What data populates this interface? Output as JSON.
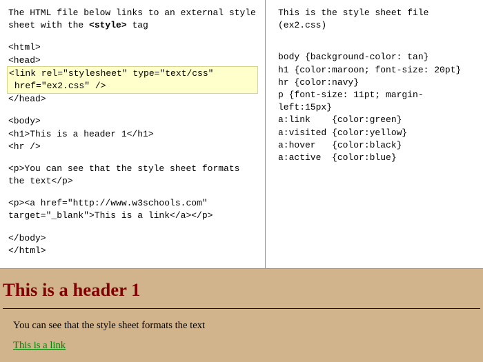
{
  "left": {
    "intro_before": "The HTML file below links to an external style sheet with the ",
    "intro_bold": "<style>",
    "intro_after": " tag",
    "lines": [
      "<html>",
      "<head>",
      "HILITE",
      "</head>",
      "",
      "<body>",
      "<h1>This is a header 1</h1>",
      "<hr />",
      "",
      "<p>You can see that the style sheet formats the text</p>",
      "",
      "<p><a href=\"http://www.w3schools.com\" target=\"_blank\">This is a link</a></p>",
      "",
      "</body>",
      "</html>"
    ],
    "hilite_line1": "<link rel=\"stylesheet\" type=\"text/css\"",
    "hilite_line2": " href=\"ex2.css\" />"
  },
  "right": {
    "intro": "This is the style sheet file (ex2.css)",
    "lines": [
      "body {background-color: tan}",
      "h1 {color:maroon; font-size: 20pt}",
      "hr {color:navy}",
      "p {font-size: 11pt; margin-left:15px}",
      "a:link    {color:green}",
      "a:visited {color:yellow}",
      "a:hover   {color:black}",
      "a:active  {color:blue}"
    ]
  },
  "preview": {
    "header": "This is a header 1",
    "para": "You can see that the style sheet formats the text",
    "link_text": "This is a link"
  }
}
